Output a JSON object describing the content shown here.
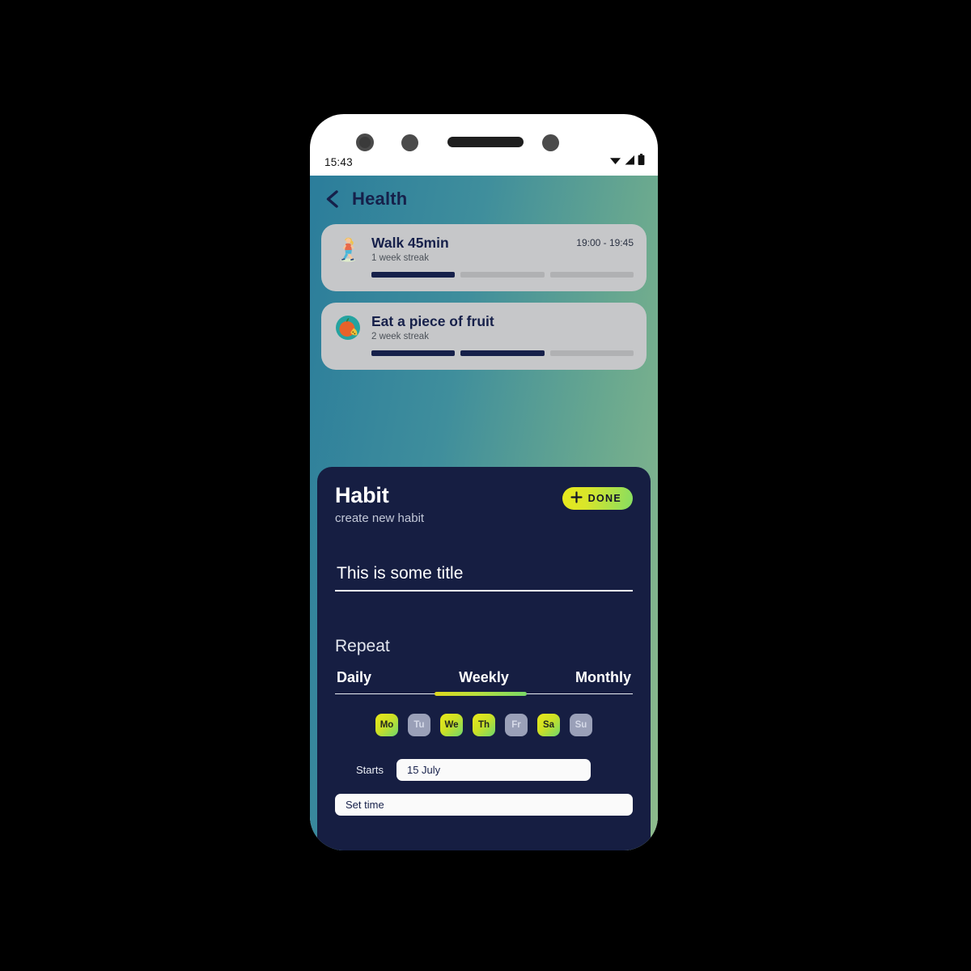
{
  "status_bar": {
    "time": "15:43",
    "icons": [
      "wifi-icon",
      "cellular-signal-icon",
      "battery-icon"
    ]
  },
  "header": {
    "back_icon": "chevron-left-icon",
    "title": "Health"
  },
  "habits": [
    {
      "emoji": "walking-woman-icon",
      "title": "Walk 45min",
      "streak": "1 week streak",
      "time": "19:00 - 19:45",
      "segments": [
        true,
        false,
        false
      ]
    },
    {
      "emoji": "fruit-icon",
      "title": "Eat a piece of fruit",
      "streak": "2 week streak",
      "time": "",
      "segments": [
        true,
        true,
        false
      ]
    }
  ],
  "sheet": {
    "title": "Habit",
    "subtitle": "create new habit",
    "done_button": {
      "icon": "plus-icon",
      "label": "DONE"
    },
    "title_input": {
      "value": "This is some title",
      "placeholder": "Title"
    },
    "repeat": {
      "label": "Repeat",
      "tabs": [
        {
          "label": "Daily",
          "active": false
        },
        {
          "label": "Weekly",
          "active": true
        },
        {
          "label": "Monthly",
          "active": false
        }
      ]
    },
    "days": [
      {
        "label": "Mo",
        "selected": true
      },
      {
        "label": "Tu",
        "selected": false
      },
      {
        "label": "We",
        "selected": true
      },
      {
        "label": "Th",
        "selected": true
      },
      {
        "label": "Fr",
        "selected": false
      },
      {
        "label": "Sa",
        "selected": true
      },
      {
        "label": "Su",
        "selected": false
      }
    ],
    "starts": {
      "label": "Starts",
      "date_value": "15 July",
      "date_placeholder": "Pick date"
    },
    "set_time": {
      "value": "Set time",
      "placeholder": "Set time"
    }
  },
  "colors": {
    "accent_yellow": "#e9e81b",
    "accent_green": "#6fd86d",
    "sheet_bg": "#161e42",
    "card_bg": "#c6c7c9",
    "screen_gradient_start": "#2b7d9b",
    "screen_gradient_end": "#8ebb8c",
    "navy_text": "#16204a"
  }
}
